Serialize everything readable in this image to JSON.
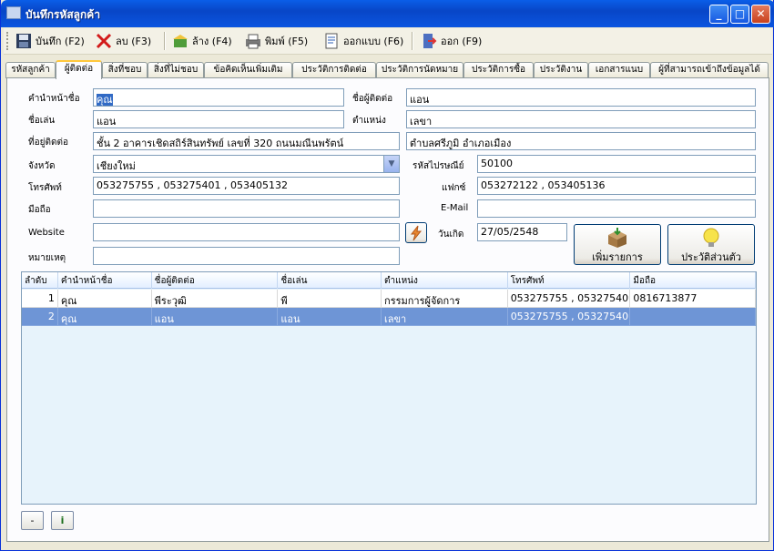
{
  "window": {
    "title": "บันทึกรหัสลูกค้า",
    "minimize": "_",
    "maximize": "□",
    "close": "✕"
  },
  "toolbar": [
    {
      "label": "บันทึก (F2)",
      "icon": "save-icon"
    },
    {
      "label": "ลบ (F3)",
      "icon": "delete-icon"
    },
    {
      "label": "ล้าง (F4)",
      "icon": "clear-icon"
    },
    {
      "label": "พิมพ์ (F5)",
      "icon": "print-icon"
    },
    {
      "label": "ออกแบบ (F6)",
      "icon": "design-icon"
    },
    {
      "label": "ออก (F9)",
      "icon": "exit-icon"
    }
  ],
  "tabs": [
    "รหัสลูกค้า",
    "ผู้ติดต่อ",
    "สิ่งที่ชอบ",
    "สิ่งที่ไม่ชอบ",
    "ข้อคิดเห็นเพิ่มเติม",
    "ประวัติการติดต่อ",
    "ประวัติการนัดหมาย",
    "ประวัติการซื้อ",
    "ประวัติงาน",
    "เอกสารแนบ",
    "ผู้ที่สามารถเข้าถึงข้อมูลได้"
  ],
  "active_tab": "ผู้ติดต่อ",
  "form": {
    "prefix_label": "คำนำหน้าชื่อ",
    "prefix_value": "คุณ",
    "contact_label": "ชื่อผู้ติดต่อ",
    "contact_value": "แอน",
    "nickname_label": "ชื่อเล่น",
    "nickname_value": "แอน",
    "position_label": "ตำแหน่ง",
    "position_value": "เลขา",
    "address_label": "ที่อยู่ติดต่อ",
    "address_value": "ชั้น 2 อาคารเชิดสถิร์สินทรัพย์ เลขที่ 320 ถนนมณีนพรัตน์",
    "address2_value": "ตำบลศรีภูมิ อำเภอเมือง",
    "province_label": "จังหวัด",
    "province_value": "เชียงใหม่",
    "zip_label": "รหัสไปรษณีย์",
    "zip_value": "50100",
    "phone_label": "โทรศัพท์",
    "phone_value": "053275755 , 053275401 , 053405132",
    "fax_label": "แฟกซ์",
    "fax_value": "053272122 , 053405136",
    "mobile_label": "มือถือ",
    "mobile_value": "",
    "email_label": "E-Mail",
    "email_value": "",
    "website_label": "Website",
    "website_value": "",
    "birthday_label": "วันเกิด",
    "birthday_value": "27/05/2548",
    "note_label": "หมายเหตุ",
    "note_value": ""
  },
  "buttons": {
    "add_item": "เพิ่มรายการ",
    "history": "ประวัติส่วนตัว",
    "minus": "-",
    "info": "i"
  },
  "grid": {
    "columns": [
      "ลำดับ",
      "คำนำหน้าชื่อ",
      "ชื่อผู้ติดต่อ",
      "ชื่อเล่น",
      "ตำแหน่ง",
      "โทรศัพท์",
      "มือถือ"
    ],
    "rows": [
      [
        "1",
        "คุณ",
        "พีระวุฒิ",
        "พี",
        "กรรมการผู้จัดการ",
        "053275755 , 05327540...",
        "0816713877"
      ],
      [
        "2",
        "คุณ",
        "แอน",
        "แอน",
        "เลขา",
        "053275755 , 05327540...",
        ""
      ]
    ],
    "selected_row": 2
  }
}
